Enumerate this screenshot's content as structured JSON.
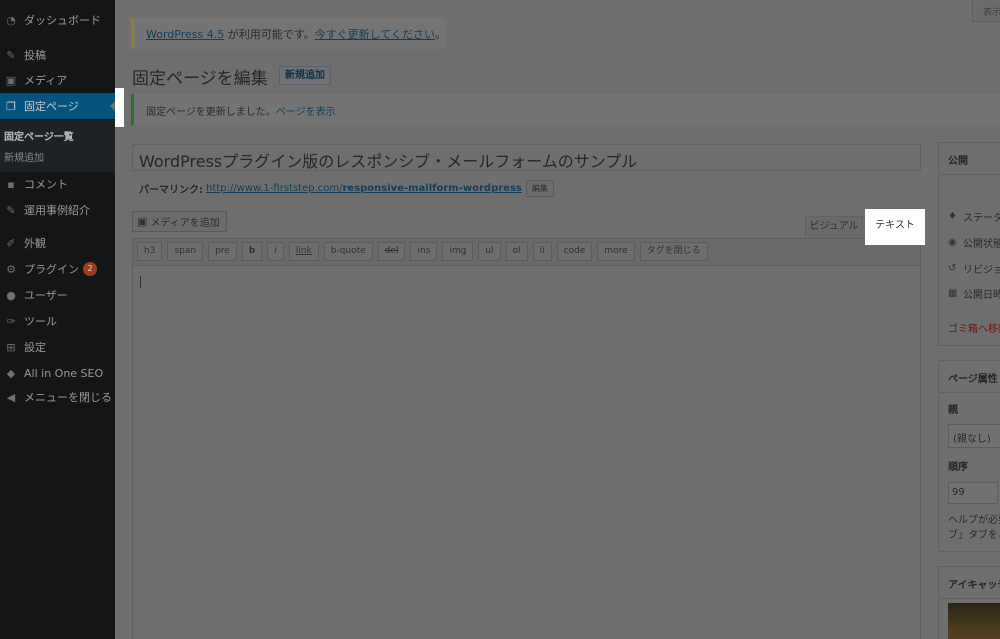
{
  "sidebar": {
    "items": [
      {
        "label": "ダッシュボード",
        "icon": "dashboard-icon"
      },
      {
        "label": "投稿",
        "icon": "pin-icon"
      },
      {
        "label": "メディア",
        "icon": "media-icon"
      },
      {
        "label": "固定ページ",
        "icon": "pages-icon"
      },
      {
        "label": "コメント",
        "icon": "comment-icon"
      },
      {
        "label": "運用事例紹介",
        "icon": "pin-icon"
      },
      {
        "label": "外観",
        "icon": "appearance-icon"
      },
      {
        "label": "プラグイン",
        "icon": "plugin-icon",
        "badge": "2"
      },
      {
        "label": "ユーザー",
        "icon": "user-icon"
      },
      {
        "label": "ツール",
        "icon": "wrench-icon"
      },
      {
        "label": "設定",
        "icon": "settings-icon"
      },
      {
        "label": "All in One SEO",
        "icon": "shield-icon"
      },
      {
        "label": "メニューを閉じる",
        "icon": "collapse-icon"
      }
    ],
    "submenu": [
      "固定ページ一覧",
      "新規追加"
    ]
  },
  "header": {
    "screen_options": "表示",
    "update_notice": {
      "link1": "WordPress 4.5",
      "middle": " が利用可能です。",
      "link2": "今すぐ更新してください",
      "end": "。"
    },
    "page_title": "固定ページを編集",
    "add_new": "新規追加",
    "updated_notice": {
      "text": "固定ページを更新しました。",
      "link": "ページを表示"
    }
  },
  "editor": {
    "title": "WordPressプラグイン版のレスポンシブ・メールフォームのサンプル",
    "permalink_label": "パーマリンク:",
    "permalink_base": "http://www.1-firststep.com/",
    "permalink_slug": "responsive-mailform-wordpress",
    "permalink_edit": "編集",
    "add_media": "メディアを追加",
    "tab_visual": "ビジュアル",
    "tab_text": "テキスト",
    "quicktags": [
      "h3",
      "span",
      "pre",
      "b",
      "i",
      "link",
      "b-quote",
      "del",
      "ins",
      "img",
      "ul",
      "ol",
      "li",
      "code",
      "more",
      "タグを閉じる"
    ]
  },
  "publish_box": {
    "title": "公開",
    "status": "ステータス",
    "visibility": "公開状態",
    "revisions": "リビジョン",
    "publish_date": "公開日時",
    "trash": "ゴミ箱へ移動"
  },
  "page_attributes": {
    "title": "ページ属性",
    "parent_label": "親",
    "parent_value": "(親なし)",
    "order_label": "順序",
    "order_value": "99",
    "help_line1": "ヘルプが必要",
    "help_line2": "ブ」タブをご"
  },
  "featured_image": {
    "title": "アイキャッチ"
  }
}
